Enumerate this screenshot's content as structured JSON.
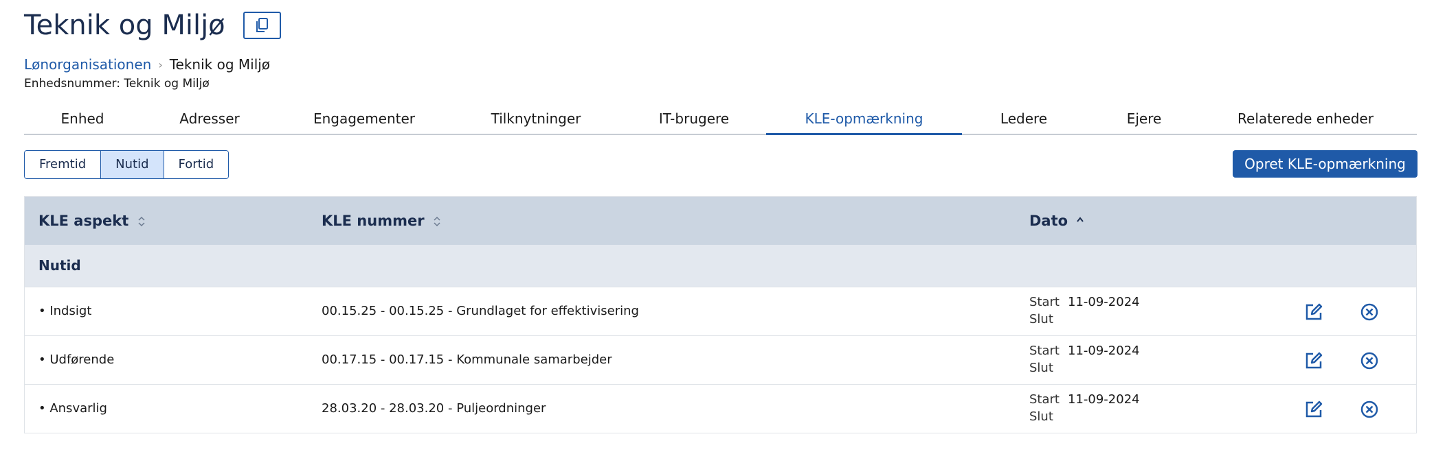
{
  "header": {
    "title": "Teknik og Miljø",
    "copy_icon": "copy-icon"
  },
  "breadcrumb": {
    "parent": "Lønorganisationen",
    "current": "Teknik og Miljø"
  },
  "unit_number": "Enhedsnummer: Teknik og Miljø",
  "tabs": [
    {
      "label": "Enhed",
      "active": false
    },
    {
      "label": "Adresser",
      "active": false
    },
    {
      "label": "Engagementer",
      "active": false
    },
    {
      "label": "Tilknytninger",
      "active": false
    },
    {
      "label": "IT-brugere",
      "active": false
    },
    {
      "label": "KLE-opmærkning",
      "active": true
    },
    {
      "label": "Ledere",
      "active": false
    },
    {
      "label": "Ejere",
      "active": false
    },
    {
      "label": "Relaterede enheder",
      "active": false
    }
  ],
  "time_filter": {
    "options": [
      "Fremtid",
      "Nutid",
      "Fortid"
    ],
    "selected": "Nutid"
  },
  "create_button": "Opret KLE-opmærkning",
  "table": {
    "columns": [
      "KLE aspekt",
      "KLE nummer",
      "Dato"
    ],
    "group": "Nutid",
    "start_label": "Start",
    "end_label": "Slut",
    "rows": [
      {
        "aspect": "• Indsigt",
        "number": "00.15.25 - 00.15.25 - Grundlaget for effektivisering",
        "start": "11-09-2024",
        "end": ""
      },
      {
        "aspect": "• Udførende",
        "number": "00.17.15 - 00.17.15 - Kommunale samarbejder",
        "start": "11-09-2024",
        "end": ""
      },
      {
        "aspect": "• Ansvarlig",
        "number": "28.03.20 - 28.03.20 - Puljeordninger",
        "start": "11-09-2024",
        "end": ""
      }
    ]
  },
  "colors": {
    "primary": "#1f5aa8",
    "title": "#1b2d4f",
    "header_bg": "#cbd5e1",
    "group_bg": "#e3e8ef",
    "active_segment": "#d4e4fb"
  }
}
